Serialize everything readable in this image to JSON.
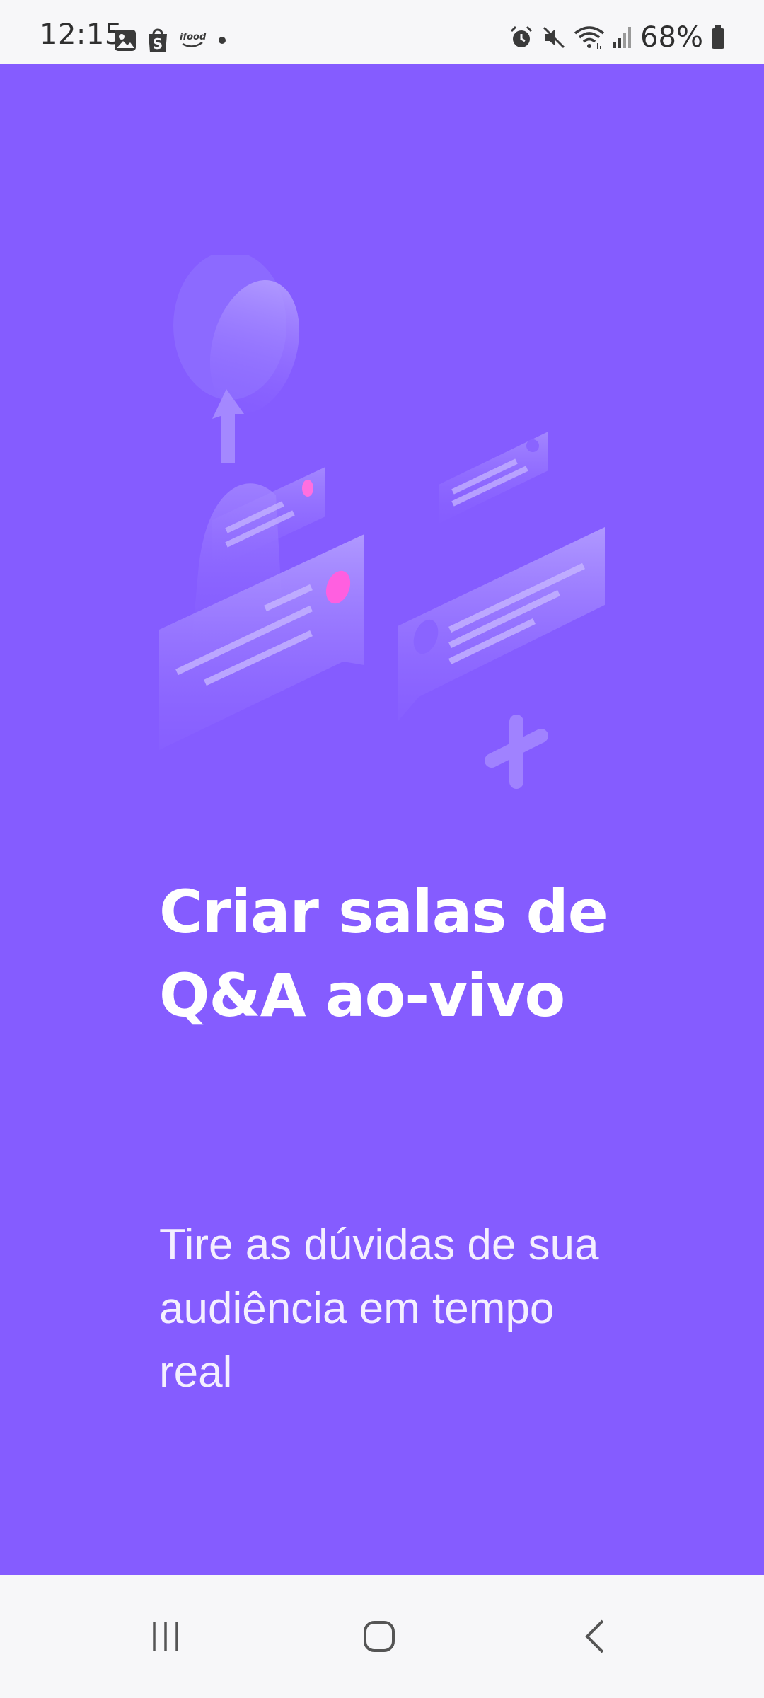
{
  "status_bar": {
    "time": "12:15",
    "battery": "68%",
    "left_icons": [
      "gallery-icon",
      "shop-icon",
      "ifood-icon",
      "dot-icon"
    ],
    "right_icons": [
      "alarm-icon",
      "mute-icon",
      "wifi-icon",
      "signal-icon",
      "battery-icon"
    ]
  },
  "onboarding": {
    "title": "Criar salas de Q&A ao-vivo",
    "subtitle": "Tire as dúvidas de sua audiência em tempo real",
    "illustration": "qa-chat-illustration",
    "background_color": "#855cff"
  },
  "nav_bar": {
    "buttons": [
      "recents-icon",
      "home-icon",
      "back-icon"
    ]
  }
}
